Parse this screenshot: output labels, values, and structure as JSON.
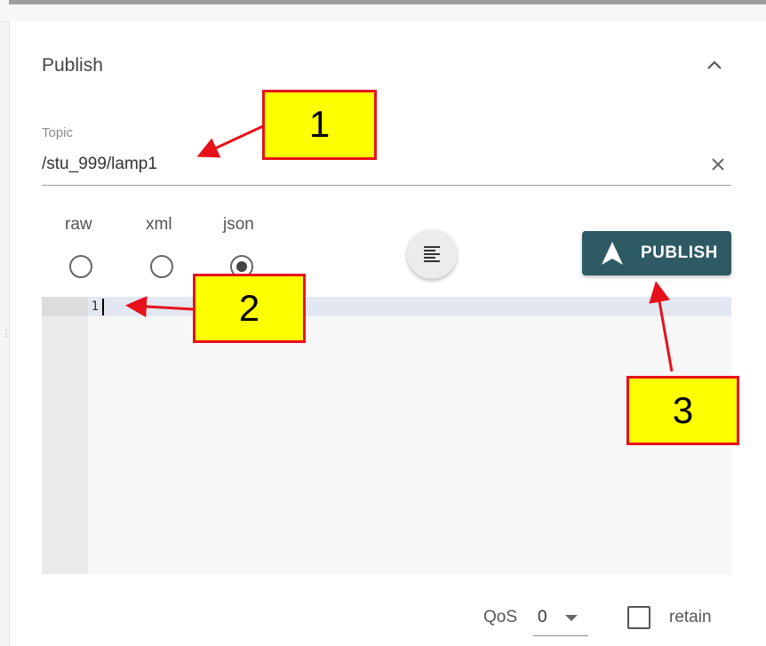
{
  "panel": {
    "title": "Publish",
    "topic_label": "Topic",
    "topic_value": "/stu_999/lamp1"
  },
  "format": {
    "options": [
      "raw",
      "xml",
      "json"
    ],
    "selected": "json"
  },
  "publish_button": {
    "label": "PUBLISH",
    "color": "#2e5a64"
  },
  "editor": {
    "line_numbers": [
      "1"
    ],
    "content": ""
  },
  "qos": {
    "label": "QoS",
    "value": "0"
  },
  "retain": {
    "label": "retain",
    "checked": false
  },
  "annotations": [
    "1",
    "2",
    "3"
  ],
  "icons": [
    "chevron-up-icon",
    "clear-icon",
    "format-align-icon",
    "send-icon",
    "chevron-down-icon"
  ],
  "colors": {
    "callout_fill": "#ffff00",
    "callout_border": "#e8101a",
    "arrow": "#e8101a"
  }
}
